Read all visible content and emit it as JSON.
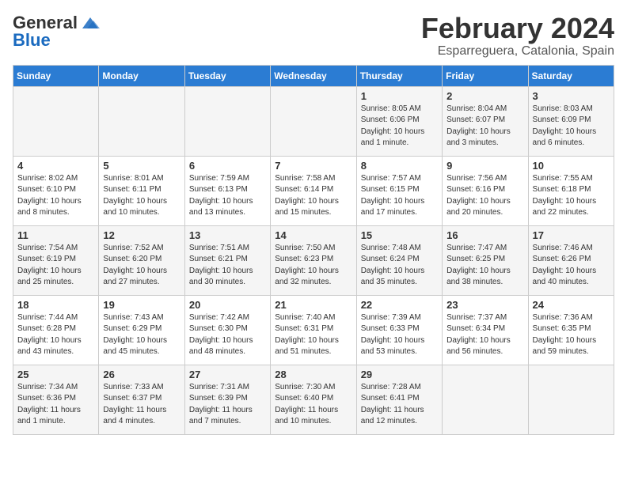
{
  "logo": {
    "line1": "General",
    "line2": "Blue"
  },
  "title": "February 2024",
  "subtitle": "Esparreguera, Catalonia, Spain",
  "days_of_week": [
    "Sunday",
    "Monday",
    "Tuesday",
    "Wednesday",
    "Thursday",
    "Friday",
    "Saturday"
  ],
  "weeks": [
    [
      {
        "day": "",
        "info": ""
      },
      {
        "day": "",
        "info": ""
      },
      {
        "day": "",
        "info": ""
      },
      {
        "day": "",
        "info": ""
      },
      {
        "day": "1",
        "info": "Sunrise: 8:05 AM\nSunset: 6:06 PM\nDaylight: 10 hours and 1 minute."
      },
      {
        "day": "2",
        "info": "Sunrise: 8:04 AM\nSunset: 6:07 PM\nDaylight: 10 hours and 3 minutes."
      },
      {
        "day": "3",
        "info": "Sunrise: 8:03 AM\nSunset: 6:09 PM\nDaylight: 10 hours and 6 minutes."
      }
    ],
    [
      {
        "day": "4",
        "info": "Sunrise: 8:02 AM\nSunset: 6:10 PM\nDaylight: 10 hours and 8 minutes."
      },
      {
        "day": "5",
        "info": "Sunrise: 8:01 AM\nSunset: 6:11 PM\nDaylight: 10 hours and 10 minutes."
      },
      {
        "day": "6",
        "info": "Sunrise: 7:59 AM\nSunset: 6:13 PM\nDaylight: 10 hours and 13 minutes."
      },
      {
        "day": "7",
        "info": "Sunrise: 7:58 AM\nSunset: 6:14 PM\nDaylight: 10 hours and 15 minutes."
      },
      {
        "day": "8",
        "info": "Sunrise: 7:57 AM\nSunset: 6:15 PM\nDaylight: 10 hours and 17 minutes."
      },
      {
        "day": "9",
        "info": "Sunrise: 7:56 AM\nSunset: 6:16 PM\nDaylight: 10 hours and 20 minutes."
      },
      {
        "day": "10",
        "info": "Sunrise: 7:55 AM\nSunset: 6:18 PM\nDaylight: 10 hours and 22 minutes."
      }
    ],
    [
      {
        "day": "11",
        "info": "Sunrise: 7:54 AM\nSunset: 6:19 PM\nDaylight: 10 hours and 25 minutes."
      },
      {
        "day": "12",
        "info": "Sunrise: 7:52 AM\nSunset: 6:20 PM\nDaylight: 10 hours and 27 minutes."
      },
      {
        "day": "13",
        "info": "Sunrise: 7:51 AM\nSunset: 6:21 PM\nDaylight: 10 hours and 30 minutes."
      },
      {
        "day": "14",
        "info": "Sunrise: 7:50 AM\nSunset: 6:23 PM\nDaylight: 10 hours and 32 minutes."
      },
      {
        "day": "15",
        "info": "Sunrise: 7:48 AM\nSunset: 6:24 PM\nDaylight: 10 hours and 35 minutes."
      },
      {
        "day": "16",
        "info": "Sunrise: 7:47 AM\nSunset: 6:25 PM\nDaylight: 10 hours and 38 minutes."
      },
      {
        "day": "17",
        "info": "Sunrise: 7:46 AM\nSunset: 6:26 PM\nDaylight: 10 hours and 40 minutes."
      }
    ],
    [
      {
        "day": "18",
        "info": "Sunrise: 7:44 AM\nSunset: 6:28 PM\nDaylight: 10 hours and 43 minutes."
      },
      {
        "day": "19",
        "info": "Sunrise: 7:43 AM\nSunset: 6:29 PM\nDaylight: 10 hours and 45 minutes."
      },
      {
        "day": "20",
        "info": "Sunrise: 7:42 AM\nSunset: 6:30 PM\nDaylight: 10 hours and 48 minutes."
      },
      {
        "day": "21",
        "info": "Sunrise: 7:40 AM\nSunset: 6:31 PM\nDaylight: 10 hours and 51 minutes."
      },
      {
        "day": "22",
        "info": "Sunrise: 7:39 AM\nSunset: 6:33 PM\nDaylight: 10 hours and 53 minutes."
      },
      {
        "day": "23",
        "info": "Sunrise: 7:37 AM\nSunset: 6:34 PM\nDaylight: 10 hours and 56 minutes."
      },
      {
        "day": "24",
        "info": "Sunrise: 7:36 AM\nSunset: 6:35 PM\nDaylight: 10 hours and 59 minutes."
      }
    ],
    [
      {
        "day": "25",
        "info": "Sunrise: 7:34 AM\nSunset: 6:36 PM\nDaylight: 11 hours and 1 minute."
      },
      {
        "day": "26",
        "info": "Sunrise: 7:33 AM\nSunset: 6:37 PM\nDaylight: 11 hours and 4 minutes."
      },
      {
        "day": "27",
        "info": "Sunrise: 7:31 AM\nSunset: 6:39 PM\nDaylight: 11 hours and 7 minutes."
      },
      {
        "day": "28",
        "info": "Sunrise: 7:30 AM\nSunset: 6:40 PM\nDaylight: 11 hours and 10 minutes."
      },
      {
        "day": "29",
        "info": "Sunrise: 7:28 AM\nSunset: 6:41 PM\nDaylight: 11 hours and 12 minutes."
      },
      {
        "day": "",
        "info": ""
      },
      {
        "day": "",
        "info": ""
      }
    ]
  ]
}
